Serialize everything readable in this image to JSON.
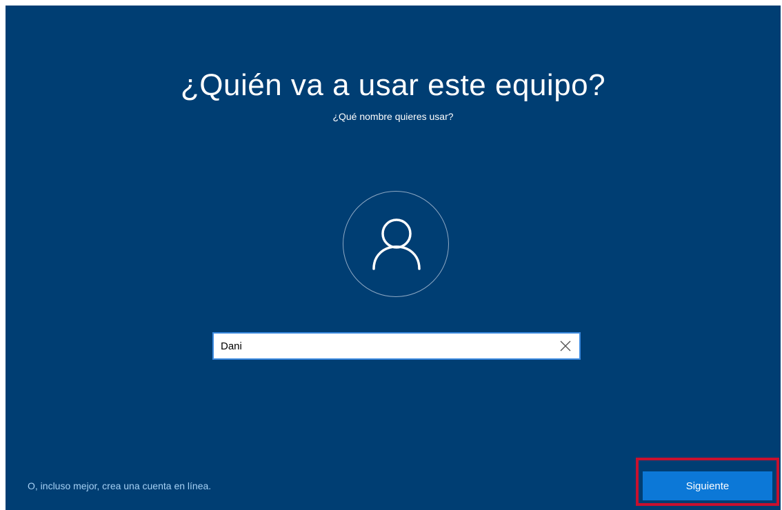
{
  "setup": {
    "title": "¿Quién va a usar este equipo?",
    "subtitle": "¿Qué nombre quieres usar?",
    "avatar_icon": "user-icon",
    "name_input": {
      "value": "Dani",
      "placeholder": ""
    },
    "clear_icon": "close-icon",
    "online_account_link": "O, incluso mejor, crea una cuenta en línea.",
    "next_button": "Siguiente"
  },
  "colors": {
    "background": "#003e73",
    "button": "#0c78d7",
    "link": "#a6d1f5",
    "input_border": "#3d8be0",
    "highlight": "#c8102e"
  }
}
